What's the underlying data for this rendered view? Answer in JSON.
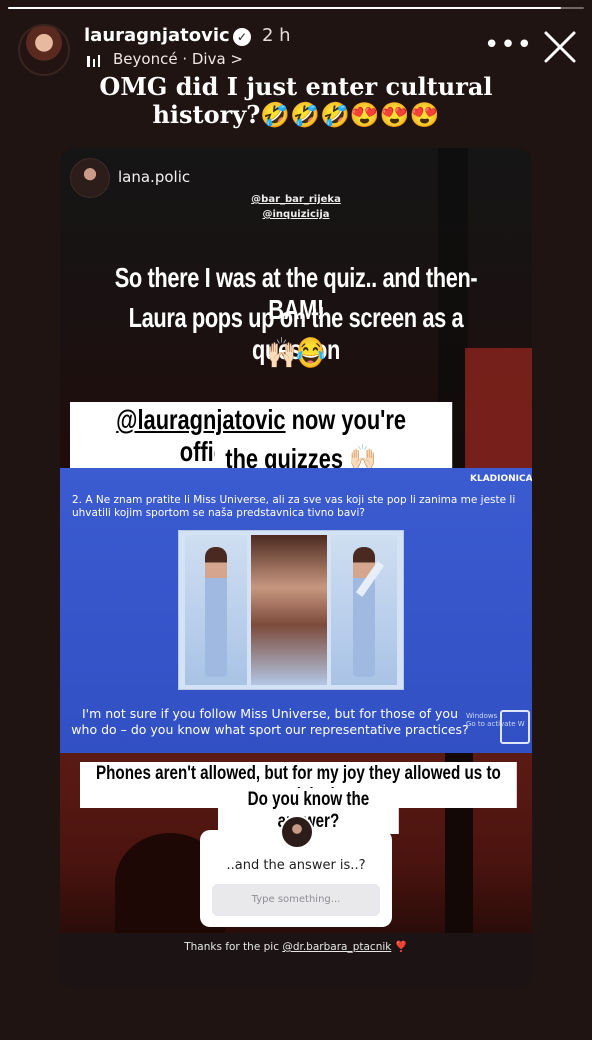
{
  "story": {
    "progress": 0.96,
    "username": "lauragnjatovic",
    "verified_glyph": "✓",
    "time": "2 h",
    "music": "Beyoncé · Diva >",
    "more_glyph": "•••",
    "caption_line1": "OMG did I just enter cultural",
    "caption_line2": "history?🤣🤣🤣😍😍😍"
  },
  "reshare": {
    "op_name": "lana.polic",
    "mention1": "@bar_bar_rijeka",
    "mention2": "@inquizicija",
    "line1": "So there I was at the quiz.. and then-BAM!",
    "line2": "Laura pops up on the screen as a question",
    "line3": "🙌🏻😂",
    "pill1_mention": "@lauragnjatovic",
    "pill1_rest": " now you're officially part of",
    "pill2": "the quizzes 🙌🏻",
    "quiz_logo": "KLADIONICA",
    "quiz_question": "2. A Ne znam pratite li Miss Universe, ali za sve vas koji ste pop    li zanima me jeste li uhvatili kojim sportom se naša predstavnica    tivno bavi?",
    "quiz_translation": "I'm not sure if you follow Miss Universe, but for those of you who do – do you know what sport our representative practices?",
    "windows_text": "Windows",
    "windows_sub": "Go to activate W",
    "phones_line": "Phones aren't allowed, but for my joy they allowed us to get a quick shot.",
    "answer_line": "Do you know the answer?",
    "sticker_title": "..and the answer is..?",
    "sticker_placeholder": "Type something...",
    "footer_prefix": "Thanks for the pic ",
    "footer_link": "@dr.barbara_ptacnik",
    "footer_heart": " ❣️"
  },
  "icons": {
    "verified": "verified-badge-icon",
    "music": "music-bars-icon",
    "more": "more-dots-icon",
    "close": "close-icon"
  }
}
